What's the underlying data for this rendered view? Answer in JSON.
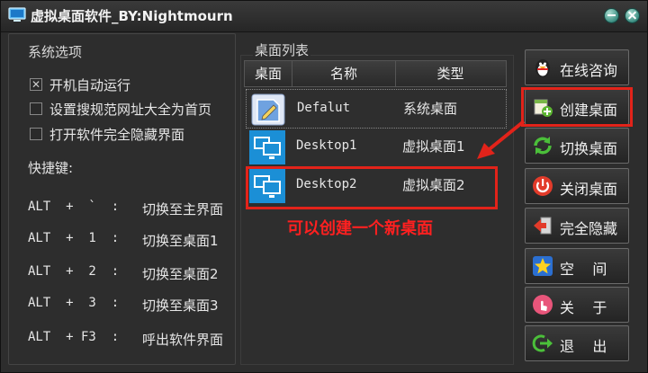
{
  "window": {
    "title": "虚拟桌面软件_BY:Nightmourn"
  },
  "options": {
    "title": "系统选项",
    "checkboxes": [
      {
        "label": "开机自动运行",
        "checked": true
      },
      {
        "label": "设置搜规范网址大全为首页",
        "checked": false
      },
      {
        "label": "打开软件完全隐藏界面",
        "checked": false
      }
    ],
    "shortcut_title": "快捷键:",
    "shortcuts": [
      {
        "keys": "ALT  +  `  :",
        "action": "切换至主界面"
      },
      {
        "keys": "ALT  +  1  :",
        "action": "切换至桌面1"
      },
      {
        "keys": "ALT  +  2  :",
        "action": "切换至桌面2"
      },
      {
        "keys": "ALT  +  3  :",
        "action": "切换至桌面3"
      },
      {
        "keys": "ALT  + F3  :",
        "action": "呼出软件界面"
      }
    ]
  },
  "desktop_list": {
    "caption": "桌面列表",
    "columns": [
      "桌面",
      "名称",
      "类型"
    ],
    "rows": [
      {
        "name": "Defalut",
        "type": "系统桌面"
      },
      {
        "name": "Desktop1",
        "type": "虚拟桌面1"
      },
      {
        "name": "Desktop2",
        "type": "虚拟桌面2"
      }
    ]
  },
  "annotation": {
    "text": "可以创建一个新桌面",
    "color": "#ff2020"
  },
  "buttons": [
    {
      "label": "在线咨询",
      "icon": "qq-penguin-icon"
    },
    {
      "label": "创建桌面",
      "icon": "create-desktop-icon"
    },
    {
      "label": "切换桌面",
      "icon": "switch-arrows-icon"
    },
    {
      "label": "关闭桌面",
      "icon": "power-icon"
    },
    {
      "label": "完全隐藏",
      "icon": "exit-arrow-icon"
    },
    {
      "label": "空    间",
      "icon": "star-icon"
    },
    {
      "label": "关    于",
      "icon": "hand-icon"
    },
    {
      "label": "退    出",
      "icon": "logout-icon"
    }
  ],
  "colors": {
    "highlight": "#e2231a",
    "accent_blue": "#1b8fd6"
  }
}
